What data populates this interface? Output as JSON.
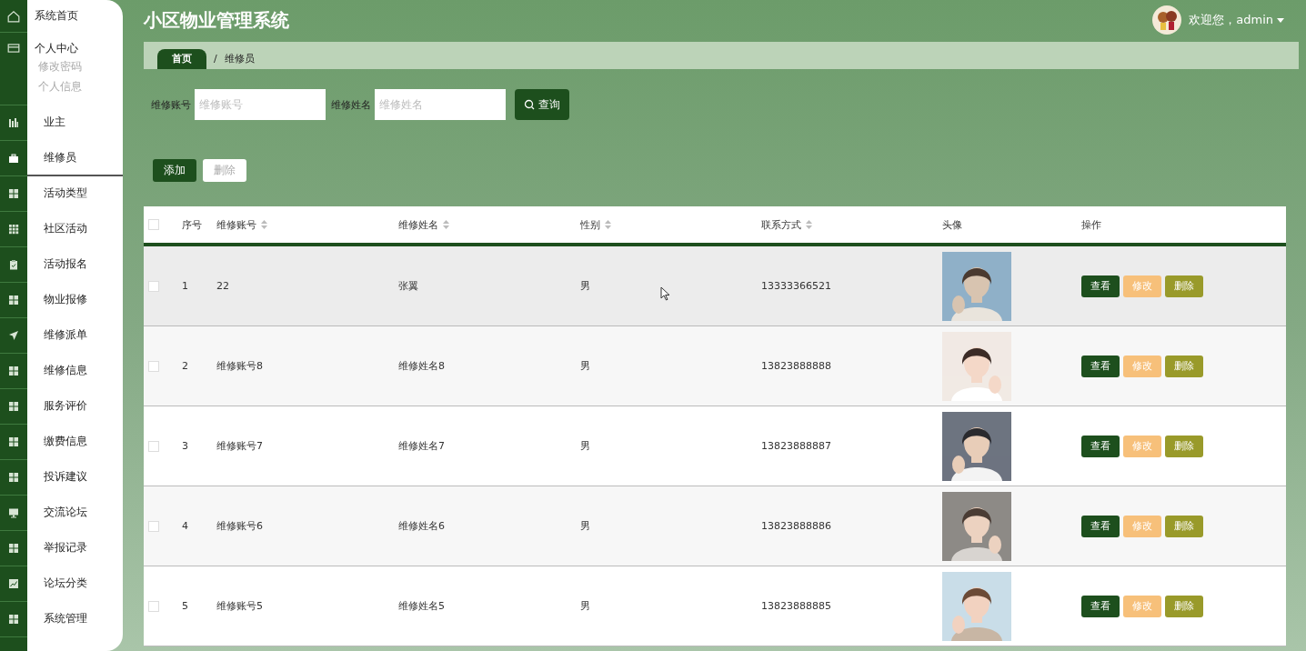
{
  "sidebar": {
    "items": [
      {
        "label": "系统首页",
        "kind": "home",
        "selected": false
      },
      {
        "label": "个人中心",
        "kind": "card",
        "selected": false,
        "children": [
          {
            "label": "修改密码"
          },
          {
            "label": "个人信息"
          }
        ]
      },
      {
        "label": "业主",
        "kind": "bars",
        "selected": false
      },
      {
        "label": "维修员",
        "kind": "briefcase",
        "selected": true
      },
      {
        "label": "活动类型",
        "kind": "grid",
        "selected": false
      },
      {
        "label": "社区活动",
        "kind": "dots",
        "selected": false
      },
      {
        "label": "活动报名",
        "kind": "clipboard",
        "selected": false
      },
      {
        "label": "物业报修",
        "kind": "grid",
        "selected": false
      },
      {
        "label": "维修派单",
        "kind": "plane",
        "selected": false
      },
      {
        "label": "维修信息",
        "kind": "grid",
        "selected": false
      },
      {
        "label": "服务评价",
        "kind": "grid",
        "selected": false
      },
      {
        "label": "缴费信息",
        "kind": "grid",
        "selected": false
      },
      {
        "label": "投诉建议",
        "kind": "grid",
        "selected": false
      },
      {
        "label": "交流论坛",
        "kind": "monitor",
        "selected": false
      },
      {
        "label": "举报记录",
        "kind": "grid",
        "selected": false
      },
      {
        "label": "论坛分类",
        "kind": "chart",
        "selected": false
      },
      {
        "label": "系统管理",
        "kind": "grid",
        "selected": false
      }
    ]
  },
  "header": {
    "title": "小区物业管理系统",
    "user": "欢迎您，admin"
  },
  "breadcrumb": [
    {
      "label": "首页"
    },
    {
      "label": "维修员"
    }
  ],
  "breadcrumb_separator": "/",
  "search": {
    "fields": [
      {
        "label": "维修账号",
        "placeholder": "维修账号"
      },
      {
        "label": "维修姓名",
        "placeholder": "维修姓名"
      }
    ],
    "button": "查询"
  },
  "actions": [
    {
      "label": "添加",
      "kind": "primary",
      "disabled": false
    },
    {
      "label": "删除",
      "kind": "plain",
      "disabled": true
    }
  ],
  "table": {
    "select_all": {
      "checked": false
    },
    "columns": [
      {
        "label": "序号",
        "sortable": false
      },
      {
        "label": "维修账号",
        "sortable": true
      },
      {
        "label": "维修姓名",
        "sortable": true
      },
      {
        "label": "性别",
        "sortable": true
      },
      {
        "label": "联系方式",
        "sortable": true
      },
      {
        "label": "头像",
        "sortable": false
      },
      {
        "label": "操作",
        "sortable": false
      }
    ],
    "rows": [
      {
        "checked": false,
        "hovered": true,
        "cells": [
          "1",
          "22",
          "张翼",
          "男",
          "13333366521"
        ],
        "buttons": [
          {
            "label": "查看",
            "kind": "view"
          },
          {
            "label": "修改",
            "kind": "edit"
          },
          {
            "label": "删除",
            "kind": "delete"
          }
        ]
      },
      {
        "checked": false,
        "hovered": false,
        "cells": [
          "2",
          "维修账号8",
          "维修姓名8",
          "男",
          "13823888888"
        ],
        "buttons": [
          {
            "label": "查看",
            "kind": "view"
          },
          {
            "label": "修改",
            "kind": "edit"
          },
          {
            "label": "删除",
            "kind": "delete"
          }
        ]
      },
      {
        "checked": false,
        "hovered": false,
        "cells": [
          "3",
          "维修账号7",
          "维修姓名7",
          "男",
          "13823888887"
        ],
        "buttons": [
          {
            "label": "查看",
            "kind": "view"
          },
          {
            "label": "修改",
            "kind": "edit"
          },
          {
            "label": "删除",
            "kind": "delete"
          }
        ]
      },
      {
        "checked": false,
        "hovered": false,
        "cells": [
          "4",
          "维修账号6",
          "维修姓名6",
          "男",
          "13823888886"
        ],
        "buttons": [
          {
            "label": "查看",
            "kind": "view"
          },
          {
            "label": "修改",
            "kind": "edit"
          },
          {
            "label": "删除",
            "kind": "delete"
          }
        ]
      },
      {
        "checked": false,
        "hovered": false,
        "cells": [
          "5",
          "维修账号5",
          "维修姓名5",
          "男",
          "13823888885"
        ],
        "buttons": [
          {
            "label": "查看",
            "kind": "view"
          },
          {
            "label": "修改",
            "kind": "edit"
          },
          {
            "label": "删除",
            "kind": "delete"
          }
        ]
      }
    ]
  }
}
